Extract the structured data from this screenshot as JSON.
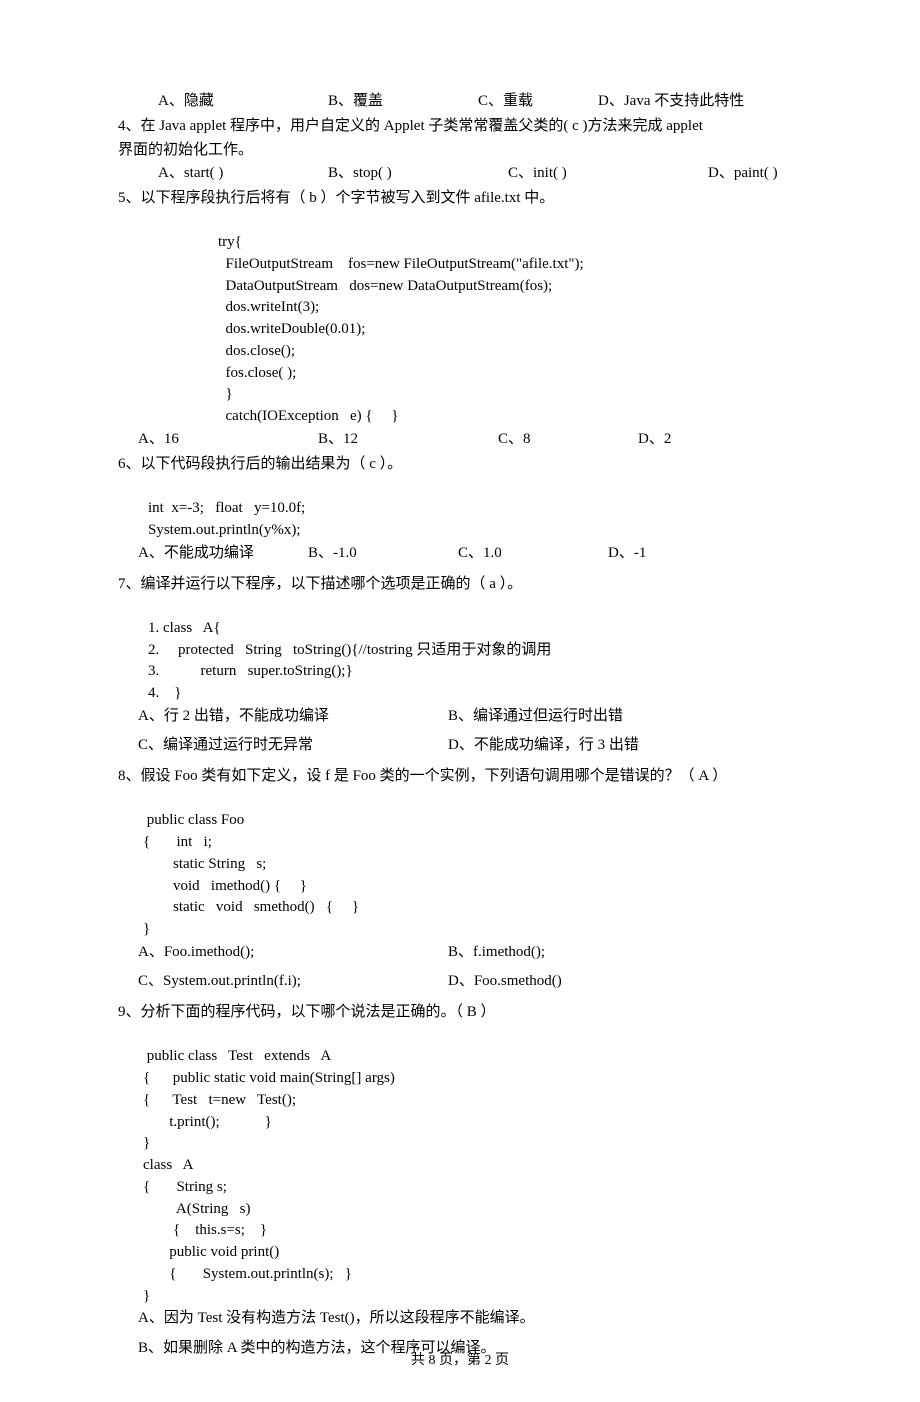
{
  "q3": {
    "opts": [
      "A、隐藏",
      "B、覆盖",
      "C、重载",
      "D、Java 不支持此特性"
    ]
  },
  "q4": {
    "stem1": "4、在 Java   applet 程序中，用户自定义的 Applet 子类常常覆盖父类的(     c   )方法来完成 applet",
    "stem2": "界面的初始化工作。",
    "opts": [
      "A、start( )",
      "B、stop( )",
      "C、init( )",
      "D、paint( )"
    ]
  },
  "q5": {
    "stem": "5、以下程序段执行后将有（ b     ）个字节被写入到文件 afile.txt 中。",
    "code": [
      "try{",
      "  FileOutputStream    fos=new FileOutputStream(\"afile.txt\");",
      "  DataOutputStream   dos=new DataOutputStream(fos);",
      "  dos.writeInt(3);",
      "  dos.writeDouble(0.01);",
      "  dos.close();",
      "  fos.close( );",
      "  }",
      "  catch(IOException   e) {     }"
    ],
    "opts": [
      "A、16",
      "B、12",
      "C、8",
      "D、2"
    ]
  },
  "q6": {
    "stem": "6、以下代码段执行后的输出结果为（ c   ）。",
    "code": [
      "int  x=-3;   float   y=10.0f;",
      "System.out.println(y%x);"
    ],
    "opts": [
      "A、不能成功编译",
      "B、-1.0",
      "C、1.0",
      "D、-1"
    ]
  },
  "q7": {
    "stem": "7、编译并运行以下程序，以下描述哪个选项是正确的（ a   ）。",
    "code": [
      "1. class   A{",
      "2.     protected   String   toString(){//tostring 只适用于对象的调用",
      "3.           return   super.toString();}",
      "4.    }"
    ],
    "optsRow1": [
      "A、行 2 出错，不能成功编译",
      "B、编译通过但运行时出错"
    ],
    "optsRow2": [
      "C、编译通过运行时无异常",
      "D、不能成功编译，行 3 出错"
    ]
  },
  "q8": {
    "stem": "8、假设 Foo 类有如下定义，设 f 是 Foo 类的一个实例，下列语句调用哪个是错误的？（ A   ）",
    "code": [
      " public class Foo",
      "{       int   i;",
      "        static String   s;",
      "        void   imethod() {     }",
      "        static   void   smethod()   {     }",
      "}"
    ],
    "optsRow1": [
      "A、Foo.imethod();",
      "B、f.imethod();"
    ],
    "optsRow2": [
      "C、System.out.println(f.i);",
      "D、Foo.smethod()"
    ]
  },
  "q9": {
    "stem": "9、分析下面的程序代码，以下哪个说法是正确的。（ B     ）",
    "code": [
      " public class   Test   extends   A",
      "{      public static void main(String[] args)",
      "{      Test   t=new   Test();",
      "       t.print();            }",
      "}",
      "class   A",
      "{       String s;",
      "         A(String   s)",
      "        {    this.s=s;    }",
      "       public void print()",
      "       {       System.out.println(s);   }",
      "}"
    ],
    "optA": "A、因为 Test 没有构造方法 Test()，所以这段程序不能编译。",
    "optB": "B、如果删除 A 类中的构造方法，这个程序可以编译。"
  },
  "footer": "共 8 页，第  2 页"
}
